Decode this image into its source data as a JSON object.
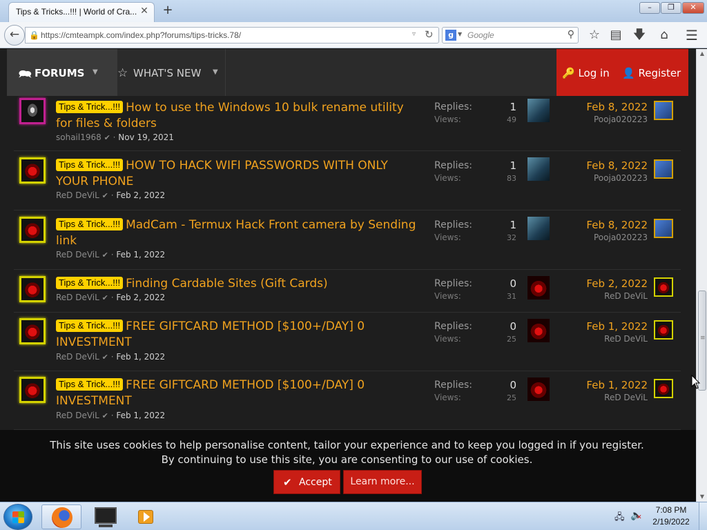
{
  "browser": {
    "tab_title": "Tips & Tricks...!!! | World of Cra...",
    "tab_close": "✕",
    "new_tab": "+",
    "url": "https://cmteampk.com/index.php?forums/tips-tricks.78/",
    "search_placeholder": "Google",
    "search_engine_letter": "g"
  },
  "site_nav": {
    "forums_label": "FORUMS",
    "whats_new_label": "WHAT'S NEW",
    "login_label": "Log in",
    "register_label": "Register"
  },
  "threads": [
    {
      "prefix": "Tips & Trick...!!!",
      "title": "How to use the Windows 10 bulk rename utility for files & folders",
      "author": "sohail1968",
      "started": "Nov 19, 2021",
      "replies_label": "Replies:",
      "replies": "1",
      "views_label": "Views:",
      "views": "49",
      "last_date": "Feb 8, 2022",
      "last_user": "Pooja020223"
    },
    {
      "prefix": "Tips & Trick...!!!",
      "title": "HOW TO HACK WIFI PASSWORDS WITH ONLY YOUR PHONE",
      "author": "ReD DeViL",
      "started": "Feb 2, 2022",
      "replies_label": "Replies:",
      "replies": "1",
      "views_label": "Views:",
      "views": "83",
      "last_date": "Feb 8, 2022",
      "last_user": "Pooja020223"
    },
    {
      "prefix": "Tips & Trick...!!!",
      "title": "MadCam - Termux Hack Front camera by Sending link",
      "author": "ReD DeViL",
      "started": "Feb 1, 2022",
      "replies_label": "Replies:",
      "replies": "1",
      "views_label": "Views:",
      "views": "32",
      "last_date": "Feb 8, 2022",
      "last_user": "Pooja020223"
    },
    {
      "prefix": "Tips & Trick...!!!",
      "title": "Finding Cardable Sites (Gift Cards)",
      "author": "ReD DeViL",
      "started": "Feb 2, 2022",
      "replies_label": "Replies:",
      "replies": "0",
      "views_label": "Views:",
      "views": "31",
      "last_date": "Feb 2, 2022",
      "last_user": "ReD DeViL"
    },
    {
      "prefix": "Tips & Trick...!!!",
      "title": "FREE GIFTCARD METHOD [$100+/DAY] 0 INVESTMENT",
      "author": "ReD DeViL",
      "started": "Feb 1, 2022",
      "replies_label": "Replies:",
      "replies": "0",
      "views_label": "Views:",
      "views": "25",
      "last_date": "Feb 1, 2022",
      "last_user": "ReD DeViL"
    },
    {
      "prefix": "Tips & Trick...!!!",
      "title": "FREE GIFTCARD METHOD [$100+/DAY] 0 INVESTMENT",
      "author": "ReD DeViL",
      "started": "Feb 1, 2022",
      "replies_label": "Replies:",
      "replies": "0",
      "views_label": "Views:",
      "views": "25",
      "last_date": "Feb 1, 2022",
      "last_user": "ReD DeViL"
    }
  ],
  "cookie": {
    "line1": "This site uses cookies to help personalise content, tailor your experience and to keep you logged in if you register.",
    "line2": "By continuing to use this site, you are consenting to our use of cookies.",
    "accept_label": "Accept",
    "learn_label": "Learn more..."
  },
  "taskbar": {
    "time": "7:08 PM",
    "date": "2/19/2022"
  },
  "colors": {
    "accent_red": "#c81e15",
    "title_orange": "#f0a21e",
    "prefix_yellow": "#ffd100"
  }
}
